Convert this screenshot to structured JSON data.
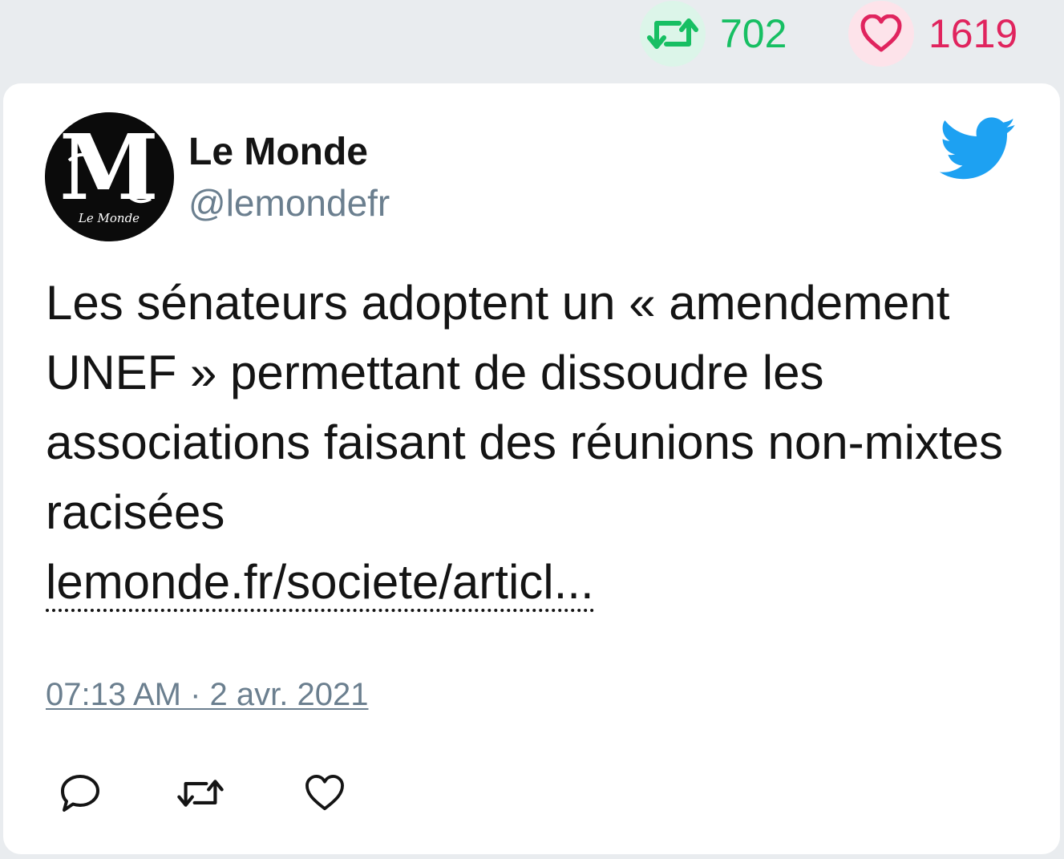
{
  "stats": {
    "retweets": "702",
    "likes": "1619"
  },
  "tweet": {
    "author_name": "Le Monde",
    "author_handle": "@lemondefr",
    "avatar_logo_text": "Le Monde",
    "text": "Les sénateurs adoptent un « amendement UNEF » permettant de dissoudre les associations faisant des réunions non-mixtes racisées",
    "link_text": "lemonde.fr/societe/articl...",
    "timestamp": "07:13 AM · 2 avr. 2021"
  },
  "icons": {
    "bird": "twitter-bird-icon",
    "reply": "reply-icon",
    "retweet": "retweet-icon",
    "like": "heart-icon"
  },
  "colors": {
    "retweet_green": "#17bf63",
    "like_red": "#e0245e",
    "twitter_blue": "#1da1f2",
    "muted_gray": "#6b7f8f"
  }
}
